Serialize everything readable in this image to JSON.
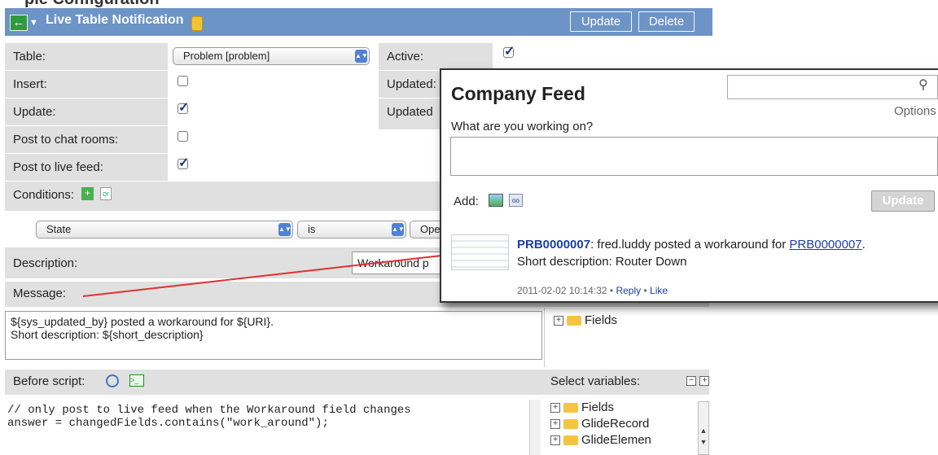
{
  "header": {
    "title": "Live Table Notification",
    "update_label": "Update",
    "delete_label": "Delete",
    "partial_top_text": "ple Configuration"
  },
  "form": {
    "table_label": "Table:",
    "table_value": "Problem [problem]",
    "insert_label": "Insert:",
    "update_label": "Update:",
    "chat_label": "Post to chat rooms:",
    "feed_label": "Post to live feed:",
    "active_label": "Active:",
    "updated1_label": "Updated:",
    "updated2_label": "Updated",
    "conditions_label": "Conditions:",
    "cond_field": "State",
    "cond_operator": "is",
    "cond_value": "Ope",
    "description_label": "Description:",
    "description_value": "Workaround p",
    "message_label": "Message:",
    "message_line1": "${sys_updated_by} posted a workaround for ${URI}.",
    "message_line2": "Short description: ${short_description}",
    "fields_label": "Fields",
    "before_script_label": "Before script:",
    "select_variables_label": "Select variables:",
    "script_line1": "// only post to live feed when the Workaround field changes",
    "script_line2": "answer = changedFields.contains(\"work_around\");",
    "tree_items": [
      "Fields",
      "GlideRecord",
      "GlideElemen"
    ]
  },
  "feed": {
    "title": "Company Feed",
    "prompt": "What are you working on?",
    "options_label": "Options",
    "add_label": "Add:",
    "update_button": "Update",
    "post_link": "PRB0000007",
    "post_text": ": fred.luddy posted a workaround for ",
    "post_link2": "PRB0000007",
    "post_end": ".",
    "post_line2": "Short description: Router Down",
    "timestamp": "2011-02-02 10:14:32",
    "reply_label": "Reply",
    "like_label": "Like",
    "sep": "•"
  },
  "checks": {
    "insert": false,
    "update": true,
    "chat": false,
    "feed": true,
    "active": true
  },
  "colors": {
    "header": "#6d94c6",
    "label_bg": "#e0e0e0",
    "arrow": "#e23030"
  }
}
